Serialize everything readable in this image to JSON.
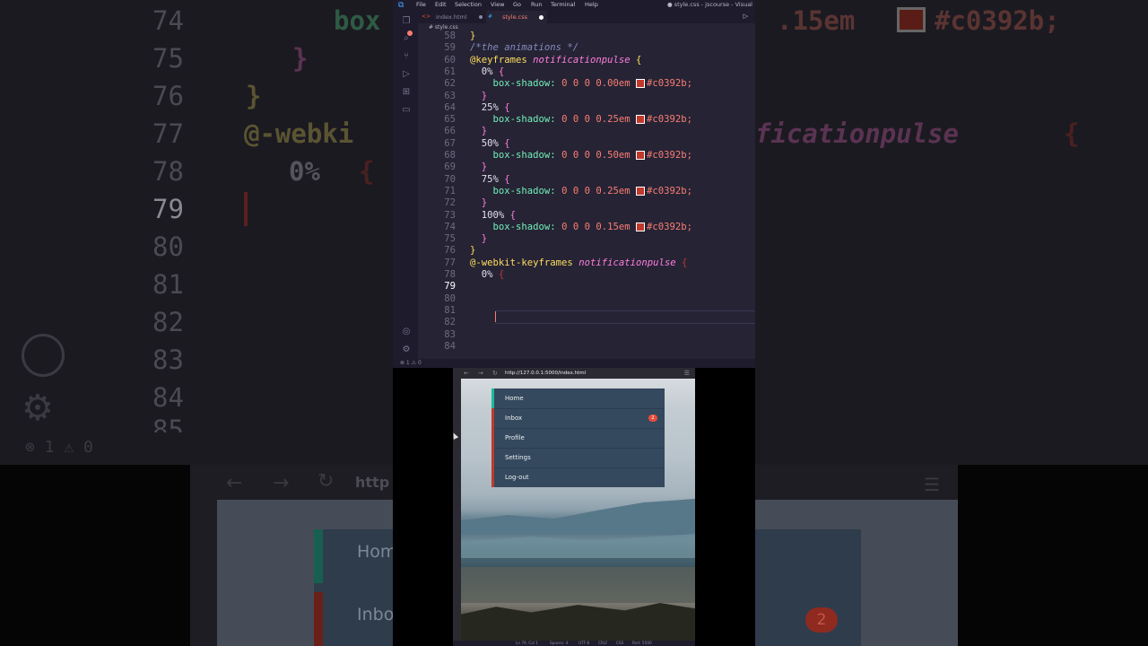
{
  "editor": {
    "menu": [
      "File",
      "Edit",
      "Selection",
      "View",
      "Go",
      "Run",
      "Terminal",
      "Help"
    ],
    "window_title": "● style.css - jscourse - Visual",
    "tabs": [
      {
        "label": "index.html",
        "icon": "html-icon"
      },
      {
        "label": "style.css",
        "icon": "css-icon",
        "active": true,
        "modified": true
      }
    ],
    "breadcrumb": "# style.css",
    "status_left": "⊗ 1 ⚠ 0",
    "lines": [
      {
        "n": "58"
      },
      {
        "n": "59"
      },
      {
        "n": "60"
      },
      {
        "n": "61"
      },
      {
        "n": "62"
      },
      {
        "n": "63"
      },
      {
        "n": "64"
      },
      {
        "n": "65"
      },
      {
        "n": "66"
      },
      {
        "n": "67"
      },
      {
        "n": "68"
      },
      {
        "n": "69"
      },
      {
        "n": "70"
      },
      {
        "n": "71"
      },
      {
        "n": "72"
      },
      {
        "n": "73"
      },
      {
        "n": "74"
      },
      {
        "n": "75"
      },
      {
        "n": "76"
      },
      {
        "n": "77"
      },
      {
        "n": "78"
      },
      {
        "n": "79"
      },
      {
        "n": "80"
      },
      {
        "n": "81"
      },
      {
        "n": "82"
      },
      {
        "n": "83"
      },
      {
        "n": "84"
      }
    ],
    "code": {
      "l58": "}",
      "l59": "/*the animations */",
      "l60a": "@keyframes",
      "l60b": "notificationpulse",
      "l60c": "{",
      "sel0": "0%",
      "sel25": "25%",
      "sel50": "50%",
      "sel75": "75%",
      "sel100": "100%",
      "open": "{",
      "close": "}",
      "prop": "box-shadow:",
      "nums": "0 0 0",
      "v0": "0.00em",
      "v25": "0.25em",
      "v50": "0.50em",
      "v75": "0.25em",
      "v100": "0.15em",
      "hex": "#c0392b;",
      "l77a": "@-webkit-keyframes",
      "l77b": "notificationpulse",
      "l77c": "{",
      "l78a": "0%",
      "l78b": "{"
    },
    "accent": "#f97e72",
    "swatch_color": "#c0392b"
  },
  "browser": {
    "url": "http://127.0.0.1:5000/index.html",
    "menu": [
      {
        "label": "Home",
        "stripe": "#1abc9c"
      },
      {
        "label": "Inbox",
        "stripe": "#c0392b",
        "badge": "2"
      },
      {
        "label": "Profile",
        "stripe": "#c0392b"
      },
      {
        "label": "Settings",
        "stripe": "#c0392b"
      },
      {
        "label": "Log-out",
        "stripe": "#c0392b"
      }
    ],
    "status": {
      "position": "Ln 79, Col 1",
      "spaces": "Spaces: 4",
      "encoding": "UTF-8",
      "eol": "CRLF",
      "lang": "CSS",
      "port": "Port: 5500"
    }
  },
  "background": {
    "gutter": [
      "74",
      "75",
      "76",
      "77",
      "78",
      "79",
      "80",
      "81",
      "82",
      "83",
      "84",
      "85"
    ],
    "code_fragments": {
      "box": "box",
      "em": ".15em",
      "hex": "#c0392b;",
      "close1": "}",
      "close2": "}",
      "webkit": "@-webki",
      "pulse": "ficationpulse",
      "brace": "{",
      "zero": "0%",
      "zero_brace": "{"
    },
    "status": "⊗ 1 ⚠ 0",
    "url_fragment": "http",
    "menu": [
      "Hom",
      "Inbo"
    ],
    "badge": "2"
  }
}
